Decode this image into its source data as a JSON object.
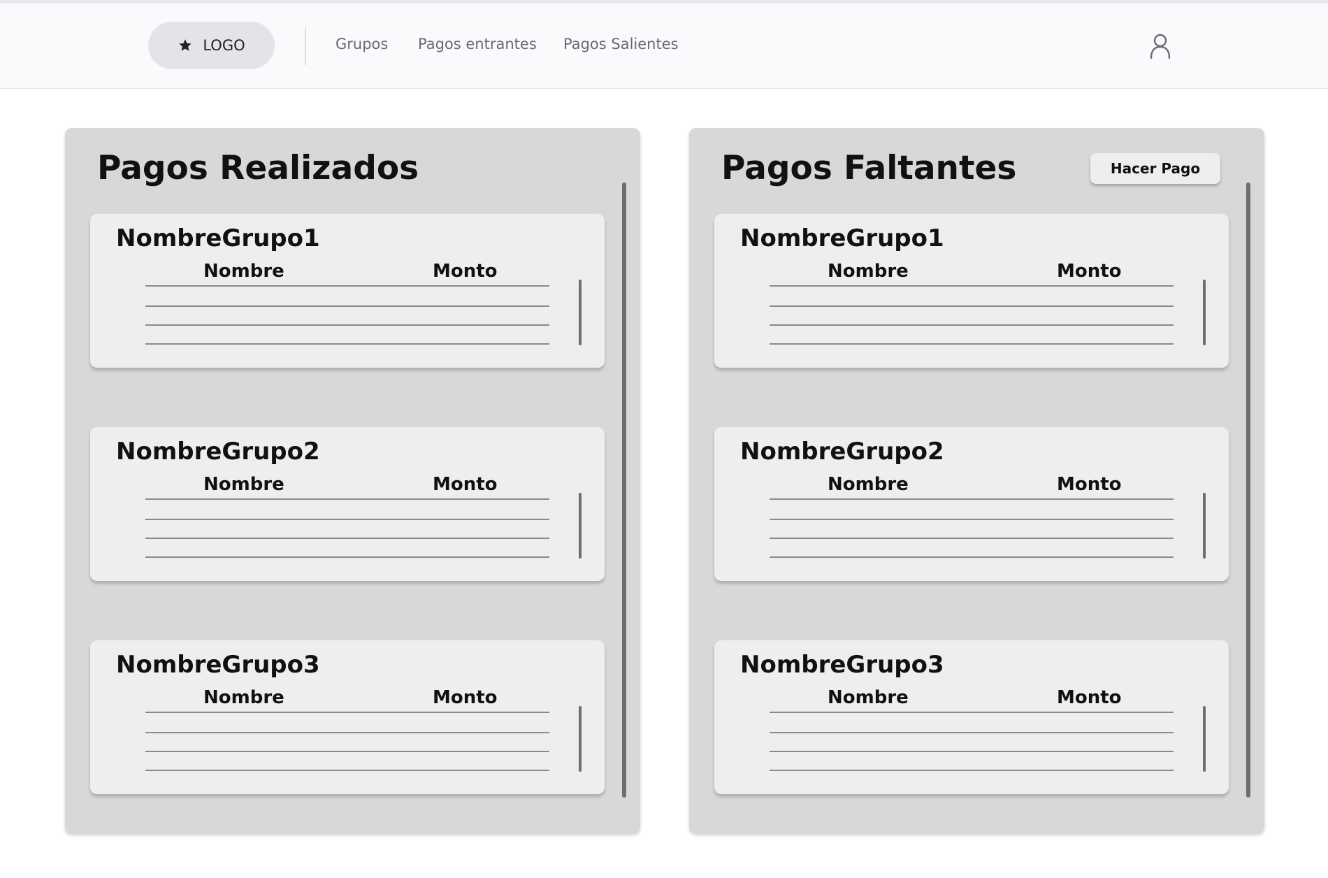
{
  "navbar": {
    "logo_label": "LOGO",
    "links": [
      "Grupos",
      "Pagos entrantes",
      "Pagos Salientes"
    ]
  },
  "panels": [
    {
      "title": "Pagos Realizados",
      "groups": [
        {
          "name": "NombreGrupo1",
          "col_name": "Nombre",
          "col_amount": "Monto"
        },
        {
          "name": "NombreGrupo2",
          "col_name": "Nombre",
          "col_amount": "Monto"
        },
        {
          "name": "NombreGrupo3",
          "col_name": "Nombre",
          "col_amount": "Monto"
        }
      ]
    },
    {
      "title": "Pagos Faltantes",
      "action_label": "Hacer Pago",
      "groups": [
        {
          "name": "NombreGrupo1",
          "col_name": "Nombre",
          "col_amount": "Monto"
        },
        {
          "name": "NombreGrupo2",
          "col_name": "Nombre",
          "col_amount": "Monto"
        },
        {
          "name": "NombreGrupo3",
          "col_name": "Nombre",
          "col_amount": "Monto"
        }
      ]
    }
  ]
}
